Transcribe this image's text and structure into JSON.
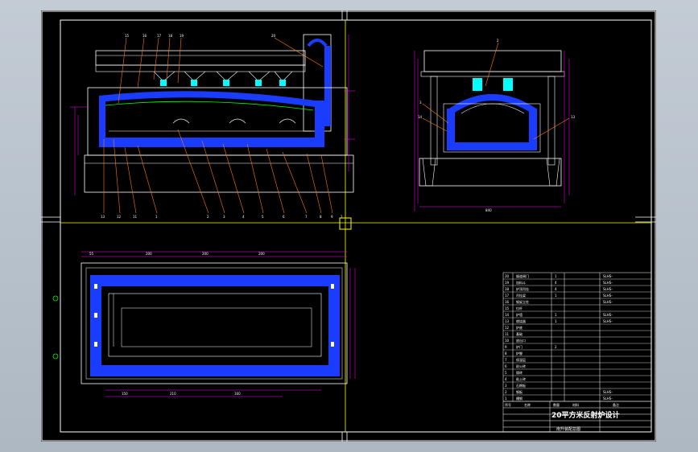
{
  "drawing": {
    "title_main": "20平方米反射炉设计",
    "title_sub": "南升装配总图",
    "colors": {
      "background": "#000000",
      "frame": "#ffffff",
      "centerline": "#ffff00",
      "brick": "#1a3cff",
      "leader": "#ff7a00",
      "dimension": "#ff00ff",
      "equipment": "#00ffff",
      "line_green": "#00ff00"
    },
    "front_view": {
      "callouts_top": [
        "15",
        "16",
        "17",
        "18",
        "19",
        "20"
      ],
      "callouts_bottom": [
        "13",
        "12",
        "11",
        "1",
        "2",
        "3",
        "4",
        "5",
        "6",
        "7",
        "8",
        "9",
        "1"
      ]
    },
    "side_view": {
      "callouts": [
        "2",
        "3",
        "14",
        "13"
      ],
      "dim_bottom": "840"
    },
    "plan_view": {
      "dim_labels": [
        "55",
        "200",
        "200",
        "200",
        "150",
        "210",
        "160"
      ]
    },
    "title_block": {
      "rows": [
        {
          "no": "20",
          "name": "烟道闸门",
          "qty": "1",
          "code": "SLHS-"
        },
        {
          "no": "19",
          "name": "加料斗",
          "qty": "4",
          "code": "SLHS-"
        },
        {
          "no": "18",
          "name": "炉顶吊挂",
          "qty": "4",
          "code": "SLHS-"
        },
        {
          "no": "17",
          "name": "吊挂梁",
          "qty": "1",
          "code": "SLHS-"
        },
        {
          "no": "16",
          "name": "钢架立柱",
          "qty": "",
          "code": "SLHS-"
        },
        {
          "no": "15",
          "name": "拉杆",
          "qty": "",
          "code": ""
        },
        {
          "no": "14",
          "name": "炉墙",
          "qty": "1",
          "code": "SLHS-"
        },
        {
          "no": "13",
          "name": "燃烧器",
          "qty": "1",
          "code": "SLHS-"
        },
        {
          "no": "12",
          "name": "炉底",
          "qty": "",
          "code": ""
        },
        {
          "no": "11",
          "name": "基础",
          "qty": "",
          "code": ""
        },
        {
          "no": "10",
          "name": "放出口",
          "qty": "",
          "code": ""
        },
        {
          "no": "9",
          "name": "炉门",
          "qty": "2",
          "code": ""
        },
        {
          "no": "8",
          "name": "炉膛",
          "qty": "",
          "code": ""
        },
        {
          "no": "7",
          "name": "保温层",
          "qty": "",
          "code": ""
        },
        {
          "no": "6",
          "name": "耐火砖",
          "qty": "",
          "code": ""
        },
        {
          "no": "5",
          "name": "镁砖",
          "qty": "",
          "code": ""
        },
        {
          "no": "4",
          "name": "粘土砖",
          "qty": "",
          "code": ""
        },
        {
          "no": "3",
          "name": "石棉板",
          "qty": "",
          "code": ""
        },
        {
          "no": "2",
          "name": "钢板",
          "qty": "",
          "code": "SLHS-"
        },
        {
          "no": "1",
          "name": "槽钢",
          "qty": "",
          "code": "SLHS-"
        }
      ],
      "header": {
        "no": "序号",
        "name": "名称",
        "qty": "数量",
        "material": "材料",
        "note": "备注"
      }
    }
  }
}
